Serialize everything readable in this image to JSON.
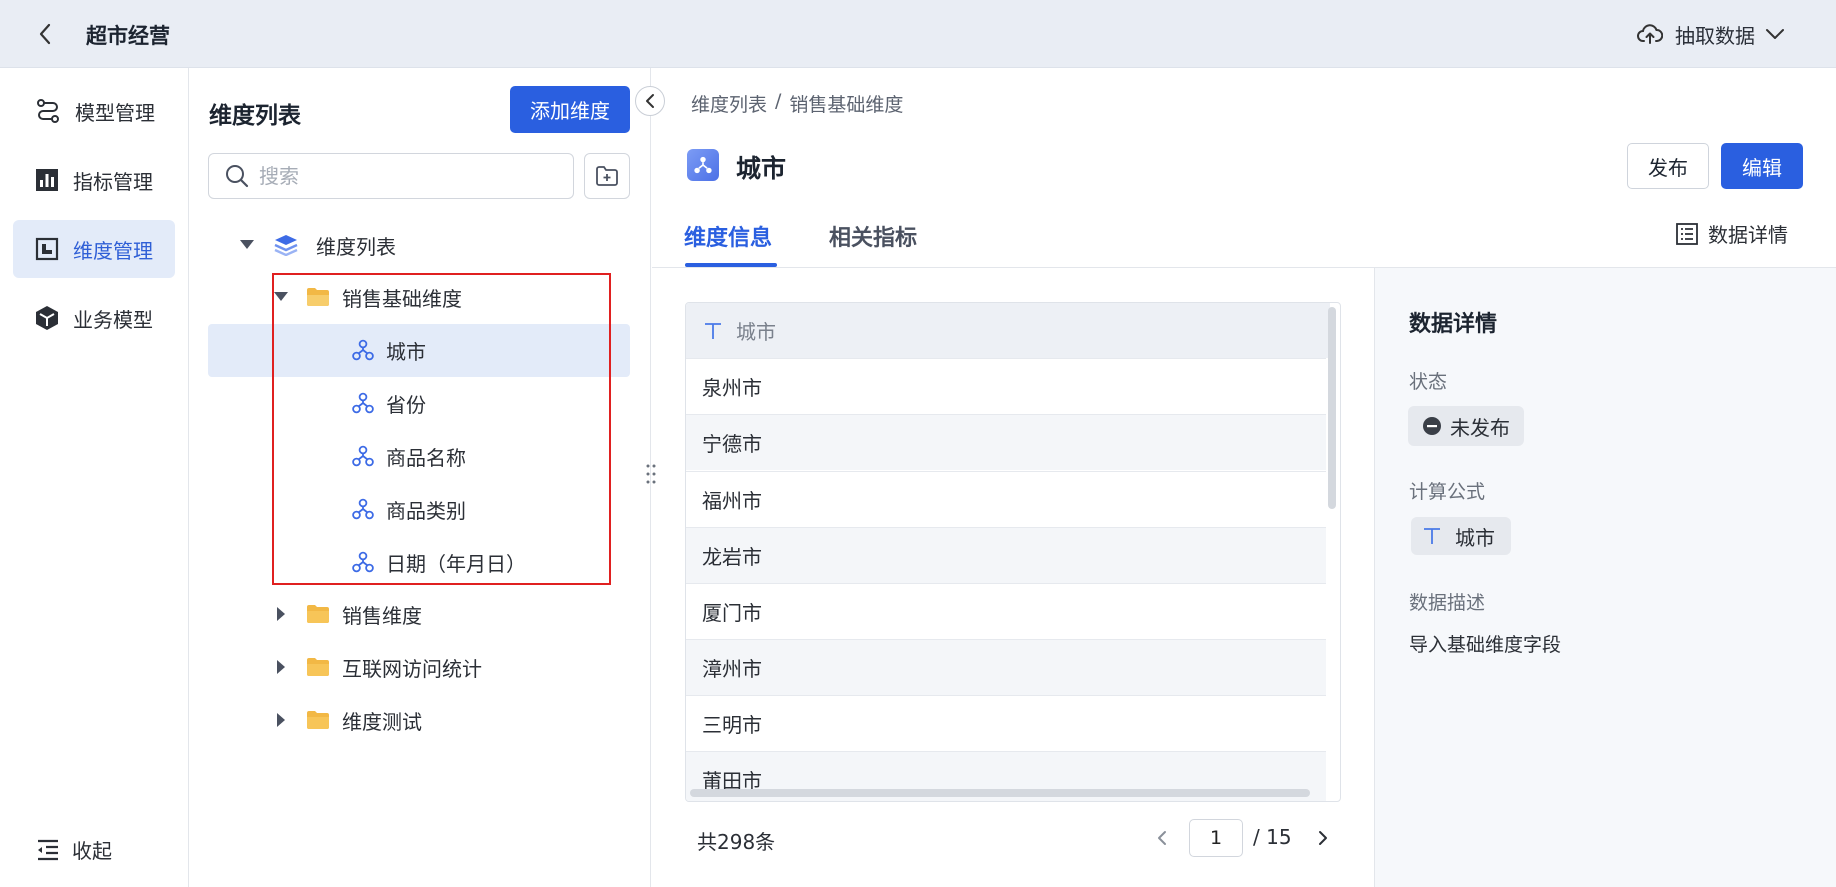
{
  "app": {
    "title": "超市经营",
    "extract_label": "抽取数据"
  },
  "sidenav": {
    "items": [
      {
        "label": "模型管理",
        "icon": "model-icon"
      },
      {
        "label": "指标管理",
        "icon": "metrics-icon"
      },
      {
        "label": "维度管理",
        "icon": "dimension-icon",
        "active": true
      },
      {
        "label": "业务模型",
        "icon": "cube-icon"
      }
    ],
    "collapse_label": "收起"
  },
  "tree_panel": {
    "title": "维度列表",
    "add_button": "添加维度",
    "search_placeholder": "搜索",
    "root": "维度列表",
    "folders": [
      {
        "label": "销售基础维度",
        "expanded": true,
        "children": [
          "城市",
          "省份",
          "商品名称",
          "商品类别",
          "日期（年月日）"
        ]
      },
      {
        "label": "销售维度",
        "expanded": false
      },
      {
        "label": "互联网访问统计",
        "expanded": false
      },
      {
        "label": "维度测试",
        "expanded": false
      }
    ],
    "selected": "城市"
  },
  "main": {
    "breadcrumb": [
      "维度列表",
      "/",
      "销售基础维度"
    ],
    "title": "城市",
    "publish_button": "发布",
    "edit_button": "编辑",
    "tabs": [
      {
        "label": "维度信息",
        "active": true
      },
      {
        "label": "相关指标",
        "active": false
      }
    ],
    "data_detail_link": "数据详情",
    "table": {
      "header": "城市",
      "header_type_icon": "text-type-icon",
      "rows": [
        "泉州市",
        "宁德市",
        "福州市",
        "龙岩市",
        "厦门市",
        "漳州市",
        "三明市",
        "莆田市"
      ]
    },
    "pagination": {
      "total_text": "共298条",
      "current_page": "1",
      "total_pages": "/ 15"
    }
  },
  "detail_panel": {
    "title": "数据详情",
    "status_label": "状态",
    "status_value": "未发布",
    "formula_label": "计算公式",
    "formula_value": "城市",
    "description_label": "数据描述",
    "description_value": "导入基础维度字段"
  },
  "colors": {
    "accent": "#2a5fe0",
    "highlight_box": "#e02020",
    "folder": "#f2b845"
  }
}
